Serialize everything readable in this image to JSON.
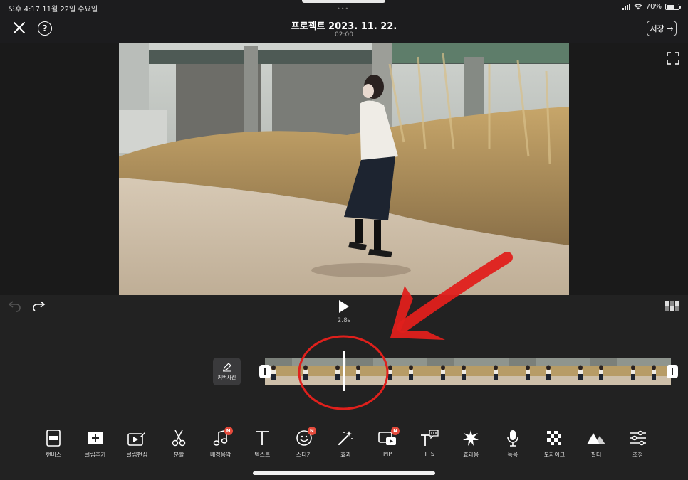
{
  "status_bar": {
    "time_date": "오후 4:17   11월 22일 수요일",
    "battery_text": "70%",
    "battery_level": 0.7
  },
  "header": {
    "project_title": "프로젝트 2023. 11. 22.",
    "duration": "02:00",
    "save_label": "저장 →",
    "help_glyph": "?"
  },
  "playback": {
    "current_time": "2.8s"
  },
  "timeline": {
    "cover_label": "커버사진",
    "frame_count": 15
  },
  "toolbar": {
    "tools": [
      {
        "label": "캔버스",
        "icon": "canvas-icon",
        "badge": ""
      },
      {
        "label": "클립추가",
        "icon": "add-clip-icon",
        "badge": ""
      },
      {
        "label": "클립편집",
        "icon": "edit-clip-icon",
        "badge": ""
      },
      {
        "label": "분할",
        "icon": "scissors-icon",
        "badge": ""
      },
      {
        "label": "배경음악",
        "icon": "music-note-icon",
        "badge": "N"
      },
      {
        "label": "텍스트",
        "icon": "text-icon",
        "badge": ""
      },
      {
        "label": "스티커",
        "icon": "sticker-icon",
        "badge": "N"
      },
      {
        "label": "효과",
        "icon": "magic-wand-icon",
        "badge": ""
      },
      {
        "label": "PIP",
        "icon": "pip-icon",
        "badge": "N"
      },
      {
        "label": "TTS",
        "icon": "tts-icon",
        "badge": ""
      },
      {
        "label": "효과음",
        "icon": "sound-effect-icon",
        "badge": ""
      },
      {
        "label": "녹음",
        "icon": "microphone-icon",
        "badge": ""
      },
      {
        "label": "모자이크",
        "icon": "mosaic-icon",
        "badge": ""
      },
      {
        "label": "필터",
        "icon": "filter-icon",
        "badge": ""
      },
      {
        "label": "조정",
        "icon": "adjust-sliders-icon",
        "badge": ""
      }
    ]
  },
  "colors": {
    "background": "#1c1c1e",
    "annotation_red": "#e0201c",
    "badge_red": "#e54b3c"
  }
}
